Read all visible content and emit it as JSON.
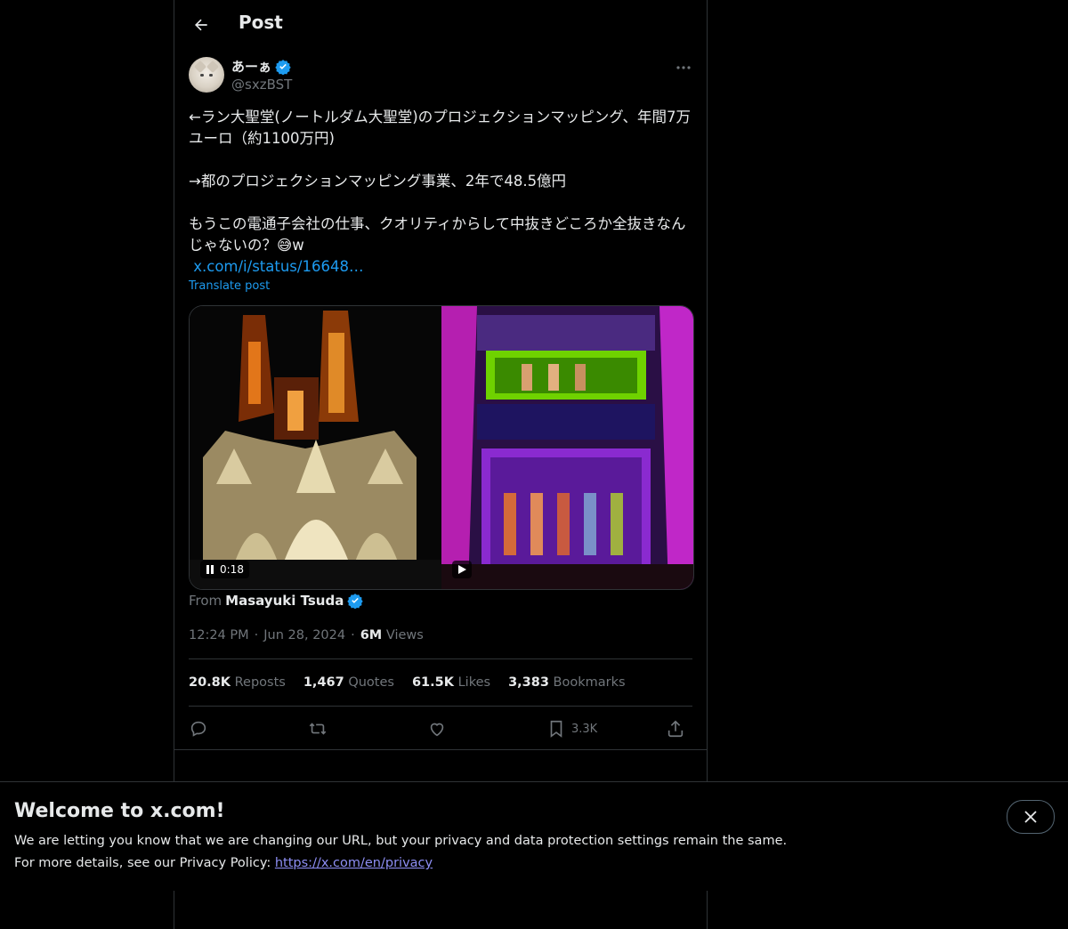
{
  "header": {
    "title": "Post"
  },
  "author": {
    "display_name": "あーぁ",
    "handle": "@sxzBST",
    "verified": true
  },
  "tweet": {
    "text": "←ラン大聖堂(ノートルダム大聖堂)のプロジェクションマッピング、年間7万ユーロ（約1100万円)\n\n→都のプロジェクションマッピング事業、2年で48.5億円\n\nもうこの電通子会社の仕事、クオリティからして中抜きどころか全抜きなんじゃないの？😅w",
    "link": "x.com/i/status/16648…",
    "translate_label": "Translate post"
  },
  "media": {
    "left_video_time": "0:18"
  },
  "source": {
    "prefix": "From",
    "author": "Masayuki Tsuda"
  },
  "meta": {
    "time": "12:24 PM",
    "date": "Jun 28, 2024",
    "views_count": "6M",
    "views_label": "Views"
  },
  "stats": [
    {
      "value": "20.8K",
      "label": "Reposts"
    },
    {
      "value": "1,467",
      "label": "Quotes"
    },
    {
      "value": "61.5K",
      "label": "Likes"
    },
    {
      "value": "3,383",
      "label": "Bookmarks"
    }
  ],
  "actions": {
    "bookmark_count": "3.3K"
  },
  "banner": {
    "title": "Welcome to x.com!",
    "line1": "We are letting you know that we are changing our URL, but your privacy and data protection settings remain the same.",
    "line2_prefix": "For more details, see our Privacy Policy: ",
    "link": "https://x.com/en/privacy"
  },
  "colors": {
    "accent": "#1d9bf0",
    "background": "#000000",
    "muted": "#71767b",
    "border": "#2f3336"
  }
}
